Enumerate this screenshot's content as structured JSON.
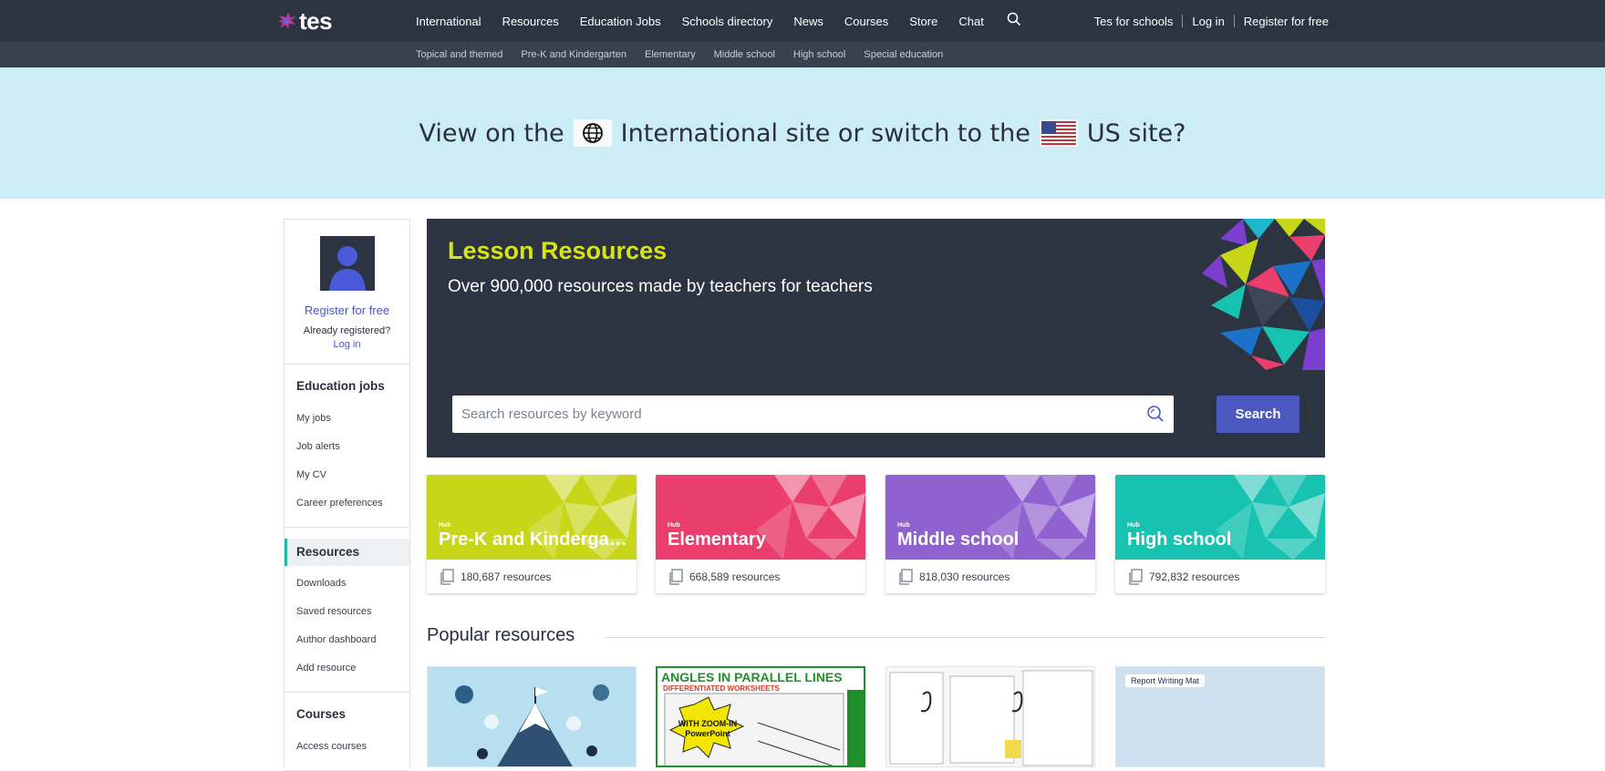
{
  "brand": {
    "name": "tes"
  },
  "nav": {
    "items": [
      "International",
      "Resources",
      "Education Jobs",
      "Schools directory",
      "News",
      "Courses",
      "Store",
      "Chat"
    ],
    "right": [
      "Tes for schools",
      "Log in",
      "Register for free"
    ],
    "sub_items": [
      "Topical and themed",
      "Pre-K and Kindergarten",
      "Elementary",
      "Middle school",
      "High school",
      "Special education"
    ]
  },
  "banner": {
    "prefix": "View on the",
    "international": "International site or switch to the",
    "us": "US site?"
  },
  "sidebar": {
    "register": "Register for free",
    "already": "Already registered?",
    "login": "Log in",
    "jobs_head": "Education jobs",
    "jobs_items": [
      "My jobs",
      "Job alerts",
      "My CV",
      "Career preferences"
    ],
    "resources_head": "Resources",
    "resources_items": [
      "Downloads",
      "Saved resources",
      "Author dashboard",
      "Add resource"
    ],
    "courses_head": "Courses",
    "courses_items": [
      "Access courses"
    ]
  },
  "hero": {
    "title": "Lesson Resources",
    "subtitle": "Over 900,000 resources made by teachers for teachers",
    "search_placeholder": "Search resources by keyword",
    "search_button": "Search"
  },
  "hubs": [
    {
      "tag": "Hub",
      "name": "Pre-K and Kindergarten",
      "count": "180,687 resources",
      "color": "#c8d61a"
    },
    {
      "tag": "Hub",
      "name": "Elementary",
      "count": "668,589 resources",
      "color": "#ea3f6c"
    },
    {
      "tag": "Hub",
      "name": "Middle school",
      "count": "818,030 resources",
      "color": "#9062cf"
    },
    {
      "tag": "Hub",
      "name": "High school",
      "count": "792,832 resources",
      "color": "#17c2b0"
    }
  ],
  "popular": {
    "title": "Popular resources",
    "card2_heading": "ANGLES IN PARALLEL LINES",
    "card2_sub": "DIFFERENTIATED WORKSHEETS",
    "card2_badge": "WITH ZOOM-IN PowerPoint",
    "card4_heading": "Report Writing Mat"
  },
  "colors": {
    "nav": "#2c3442",
    "banner": "#cdedf6",
    "accent": "#4a58c0",
    "hero_title": "#d6e319"
  }
}
